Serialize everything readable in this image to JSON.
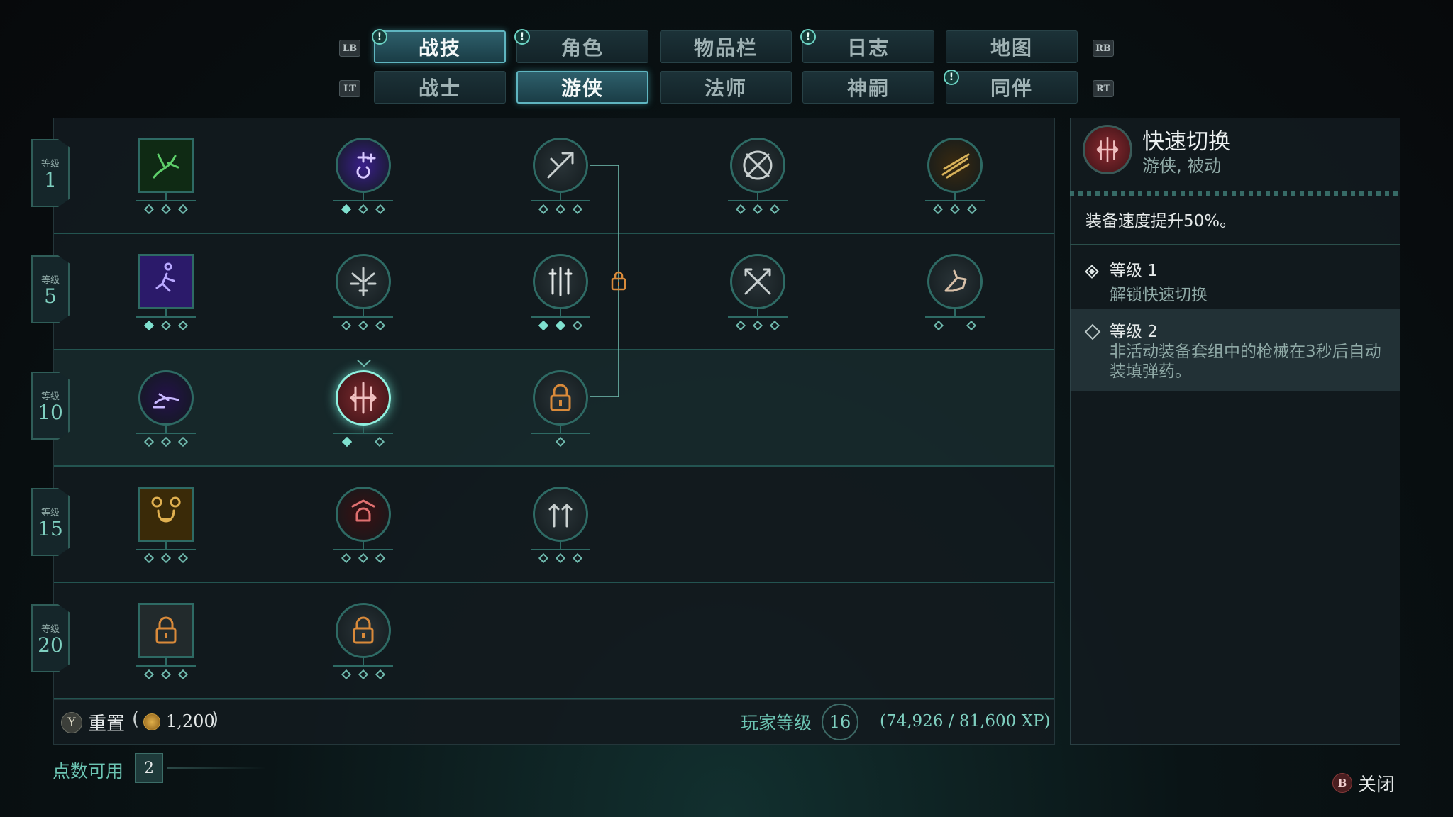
{
  "top_tabs": {
    "lb": "LB",
    "rb": "RB",
    "lt": "LT",
    "rt": "RT",
    "row1": [
      {
        "label": "战技",
        "active": true,
        "alert": true
      },
      {
        "label": "角色",
        "active": false,
        "alert": true
      },
      {
        "label": "物品栏",
        "active": false,
        "alert": false
      },
      {
        "label": "日志",
        "active": false,
        "alert": true
      },
      {
        "label": "地图",
        "active": false,
        "alert": false
      }
    ],
    "row2": [
      {
        "label": "战士",
        "active": false,
        "alert": false
      },
      {
        "label": "游侠",
        "active": true,
        "alert": false
      },
      {
        "label": "法师",
        "active": false,
        "alert": false
      },
      {
        "label": "神嗣",
        "active": false,
        "alert": false
      },
      {
        "label": "同伴",
        "active": false,
        "alert": true
      }
    ],
    "alert_glyph": "!"
  },
  "skill_tree": {
    "level_prefix": "等级",
    "tiers": [
      {
        "level": "1",
        "skills": [
          {
            "icon": "green-vine-square-icon",
            "shape": "square",
            "ranks": 3,
            "filled": 0
          },
          {
            "icon": "purple-flask-icon",
            "shape": "round",
            "ranks": 3,
            "filled": 1
          },
          {
            "icon": "piercing-shot-icon",
            "shape": "round",
            "ranks": 3,
            "filled": 0
          },
          {
            "icon": "crossbow-target-icon",
            "shape": "round",
            "ranks": 3,
            "filled": 0
          },
          {
            "icon": "gold-volley-icon",
            "shape": "round",
            "ranks": 3,
            "filled": 0
          }
        ]
      },
      {
        "level": "5",
        "skills": [
          {
            "icon": "purple-dash-square-icon",
            "shape": "square",
            "ranks": 3,
            "filled": 1
          },
          {
            "icon": "dagger-burst-icon",
            "shape": "round",
            "ranks": 3,
            "filled": 0
          },
          {
            "icon": "weapon-rack-icon",
            "shape": "round",
            "ranks": 3,
            "filled": 2
          },
          {
            "icon": "crossed-arrows-icon",
            "shape": "round",
            "ranks": 3,
            "filled": 0
          },
          {
            "icon": "gauntlet-strike-icon",
            "shape": "round",
            "ranks": 2,
            "filled": 0
          }
        ]
      },
      {
        "level": "10",
        "skills": [
          {
            "icon": "shadow-dash-icon",
            "shape": "round",
            "ranks": 3,
            "filled": 0
          },
          {
            "icon": "quick-switch-icon",
            "shape": "round",
            "ranks": 2,
            "filled": 1,
            "selected": true
          },
          {
            "icon": "locked-skill-icon",
            "shape": "round",
            "ranks": 1,
            "filled": 0,
            "locked": true
          }
        ]
      },
      {
        "level": "15",
        "skills": [
          {
            "icon": "bear-roar-square-icon",
            "shape": "square",
            "ranks": 3,
            "filled": 0
          },
          {
            "icon": "red-skull-icon",
            "shape": "round",
            "ranks": 3,
            "filled": 0
          },
          {
            "icon": "arrow-rain-icon",
            "shape": "round",
            "ranks": 3,
            "filled": 0
          }
        ]
      },
      {
        "level": "20",
        "skills": [
          {
            "icon": "locked-square-icon",
            "shape": "square",
            "ranks": 3,
            "filled": 0,
            "locked": true
          },
          {
            "icon": "locked-round-icon",
            "shape": "round",
            "ranks": 3,
            "filled": 0,
            "locked": true
          }
        ]
      }
    ]
  },
  "bottom_bar": {
    "reset_button_glyph": "Y",
    "reset_label": "重置",
    "reset_cost_open": "(",
    "reset_cost": "1,200",
    "reset_cost_close": ")",
    "player_level_label": "玩家等级",
    "player_level": "16",
    "xp_text": "(74,926 / 81,600 XP)"
  },
  "points": {
    "label": "点数可用",
    "value": "2"
  },
  "detail": {
    "title": "快速切换",
    "subtitle": "游侠, 被动",
    "description": "装备速度提升50%。",
    "ranks": [
      {
        "title": "等级 1",
        "text": "解锁快速切换",
        "filled": true
      },
      {
        "title": "等级 2",
        "text": "非活动装备套组中的枪械在3秒后自动装填弹药。",
        "filled": false
      }
    ]
  },
  "close": {
    "button_glyph": "B",
    "label": "关闭"
  },
  "colors": {
    "accent": "#6fb9ad",
    "lock": "#d98a3a",
    "selected_skill": "#8a2a30"
  }
}
